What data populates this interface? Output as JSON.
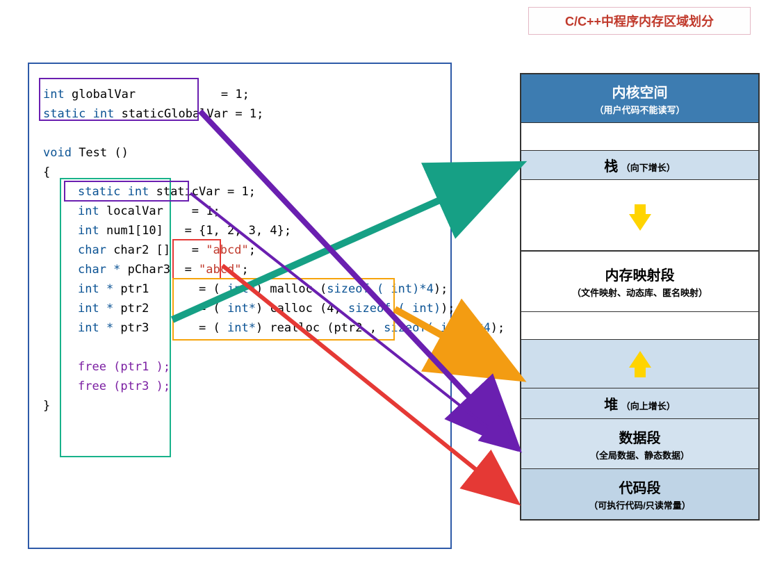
{
  "title": "C/C++中程序内存区域划分",
  "code": {
    "l1_kw": "int ",
    "l1_name": "globalVar",
    "l1_eq": "= 1;",
    "l2_kw": "static int ",
    "l2_name": "staticGlobalVar",
    "l2_eq": "= 1;",
    "l3_kw": "void ",
    "l3_name": "Test ()",
    "l4": "{",
    "l5_kw": "static int ",
    "l5_name": "staticVar",
    "l5_eq": "= 1;",
    "l6_kw": "int ",
    "l6_name": "localVar",
    "l6_eq": "= 1;",
    "l7_kw": "int ",
    "l7_name": "num1[10]",
    "l7_eq": "= {1, 2, 3, 4};",
    "l8_kw": "char ",
    "l8_name": "char2 []",
    "l8_eq": "= ",
    "l8_str": "\"abcd\"",
    "l8_end": ";",
    "l9_kw": "char * ",
    "l9_name": "pChar3",
    "l9_eq": "= ",
    "l9_str": "\"abcd\"",
    "l9_end": ";",
    "l10_kw": "int * ",
    "l10_name": "ptr1",
    "l10_eq": "= ( ",
    "l10_cast": "int*",
    "l10_fn": ") malloc (",
    "l10_arg1": "sizeof ( int)*4",
    "l10_close": ");",
    "l11_kw": "int * ",
    "l11_name": "ptr2",
    "l11_eq": "= ( ",
    "l11_cast": "int*",
    "l11_fn": ") calloc (4, ",
    "l11_arg1": "sizeof ( int)",
    "l11_close": ");",
    "l12_kw": "int * ",
    "l12_name": "ptr3",
    "l12_eq": "= ( ",
    "l12_cast": "int*",
    "l12_fn": ") realloc (ptr2 , ",
    "l12_arg1": "sizeof( int )*4",
    "l12_close": ");",
    "l13": "free (ptr1 );",
    "l14": "free (ptr3 );",
    "l15": "}"
  },
  "memory": {
    "kernel_t": "内核空间",
    "kernel_s": "（用户代码不能读写）",
    "stack_t": "栈",
    "stack_s": "（向下增长）",
    "mmap_t": "内存映射段",
    "mmap_s": "（文件映射、动态库、匿名映射）",
    "heap_t": "堆",
    "heap_s": "（向上增长）",
    "data_t": "数据段",
    "data_s": "（全局数据、静态数据）",
    "code_t": "代码段",
    "code_s": "（可执行代码/只读常量）"
  },
  "arrows": {
    "green": {
      "from": "local-vars-box",
      "to": "mem-stack",
      "color": "#16a085"
    },
    "orange": {
      "from": "malloc-box",
      "to": "mem-heap",
      "color": "#f39c12"
    },
    "purple1": {
      "from": "global-vars-box",
      "to": "mem-data",
      "color": "#6a1fb0"
    },
    "purple2": {
      "from": "static-var-box",
      "to": "mem-data",
      "color": "#6a1fb0"
    },
    "red": {
      "from": "string-literal",
      "to": "mem-code",
      "color": "#e53935"
    }
  }
}
